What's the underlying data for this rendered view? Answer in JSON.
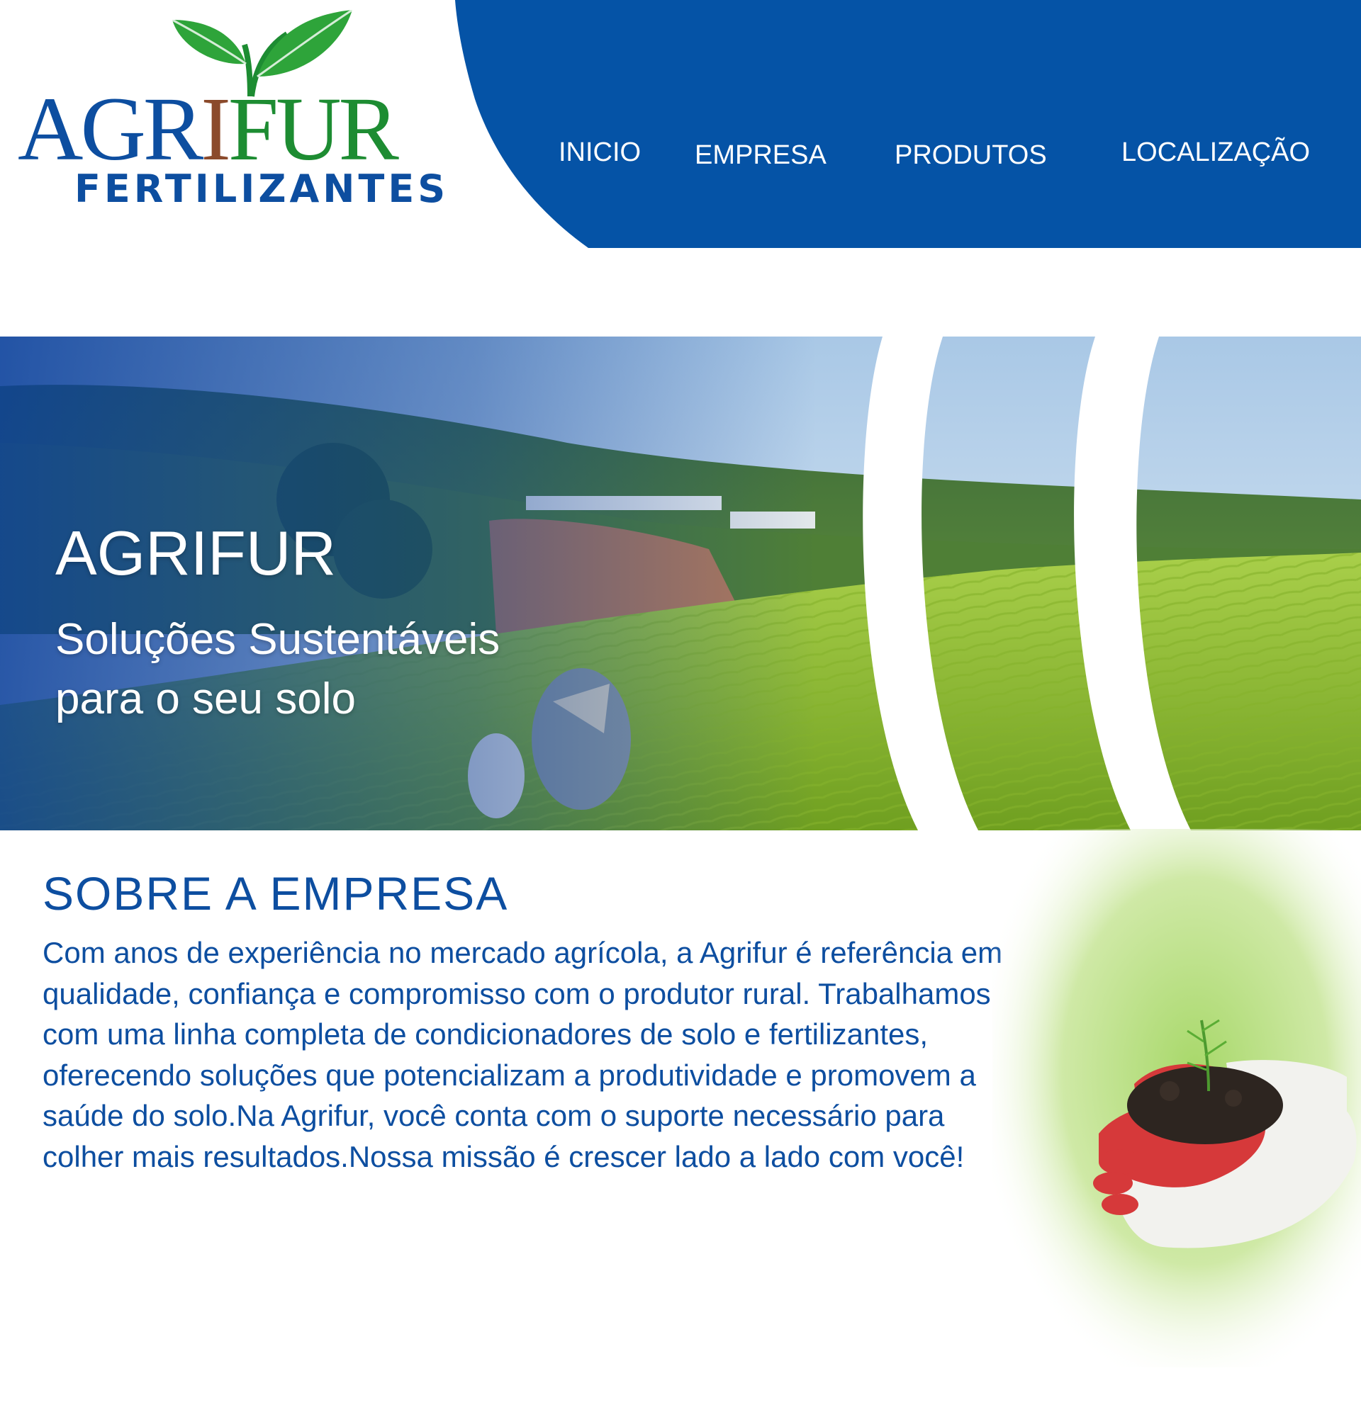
{
  "logo": {
    "word_part1": "AGR",
    "word_part2": "I",
    "word_part3": "FUR",
    "subtitle": "FERTILIZANTES"
  },
  "nav": {
    "items": [
      {
        "label": "INICIO"
      },
      {
        "label": "EMPRESA"
      },
      {
        "label": "PRODUTOS"
      },
      {
        "label": "LOCALIZAÇÃO"
      }
    ]
  },
  "hero": {
    "title": "AGRIFUR",
    "subtitle": "Soluções Sustentáveis para o seu solo"
  },
  "about": {
    "title": "SOBRE A EMPRESA",
    "text": "Com anos de experiência no mercado agrícola, a Agrifur é referência em qualidade, confiança e compromisso com o produtor rural. Trabalhamos com uma linha completa de condicionadores de solo e fertilizantes, oferecendo soluções que potencializam a produtividade e promovem a saúde do solo.Na Agrifur, você conta com o suporte necessário para colher mais resultados.Nossa missão é crescer lado a lado com você!"
  },
  "colors": {
    "brand_blue": "#0d4ea0",
    "nav_blue": "#0553a6",
    "logo_green": "#1d8c32",
    "logo_brown": "#8b4a2b"
  },
  "icons": {
    "logo_leaves": "leaf-sprout-icon"
  }
}
